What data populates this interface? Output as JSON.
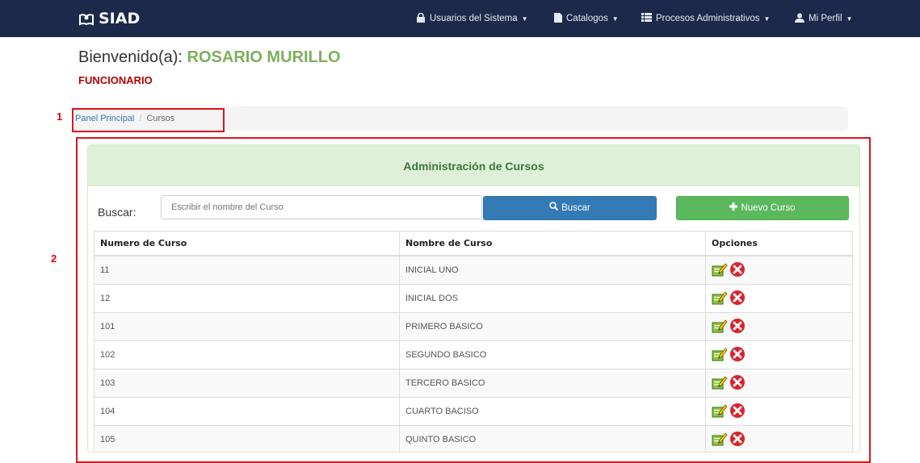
{
  "nav": {
    "brand": "SIAD",
    "usuarios": "Usuarios del Sistema",
    "catalogos": "Catalogos",
    "procesos": "Procesos Administrativos",
    "perfil": "Mi Perfil"
  },
  "welcome": {
    "prefix": "Bienvenido(a): ",
    "name": "ROSARIO MURILLO",
    "role": "FUNCIONARIO"
  },
  "annotations": {
    "one": "1",
    "two": "2"
  },
  "breadcrumb": {
    "home": "Panel Principal",
    "separator": "/",
    "current": "Cursos"
  },
  "panel": {
    "title": "Administración de Cursos"
  },
  "search": {
    "label": "Buscar:",
    "placeholder": "Escribir el nombre del Curso",
    "button": "Buscar",
    "new_button": "Nuevo Curso"
  },
  "table": {
    "headers": [
      "Numero de Curso",
      "Nombre de Curso",
      "Opciones"
    ],
    "rows": [
      [
        "11",
        "INICIAL UNO"
      ],
      [
        "12",
        "INICIAL DOS"
      ],
      [
        "101",
        "PRIMERO BASICO"
      ],
      [
        "102",
        "SEGUNDO BASICO"
      ],
      [
        "103",
        "TERCERO BASICO"
      ],
      [
        "104",
        "CUARTO BACISO"
      ],
      [
        "105",
        "QUINTO BASICO"
      ]
    ]
  },
  "colors": {
    "navbar": "#1b2a4a",
    "accent_green": "#7eae5d",
    "role_red": "#b30000",
    "primary": "#337ab7",
    "success": "#5cb85c",
    "annotation_red": "#d9151d"
  },
  "icons": [
    "book-icon",
    "lock-icon",
    "file-icon",
    "list-icon",
    "user-icon",
    "search-icon",
    "plus-icon",
    "edit-icon",
    "delete-icon"
  ]
}
